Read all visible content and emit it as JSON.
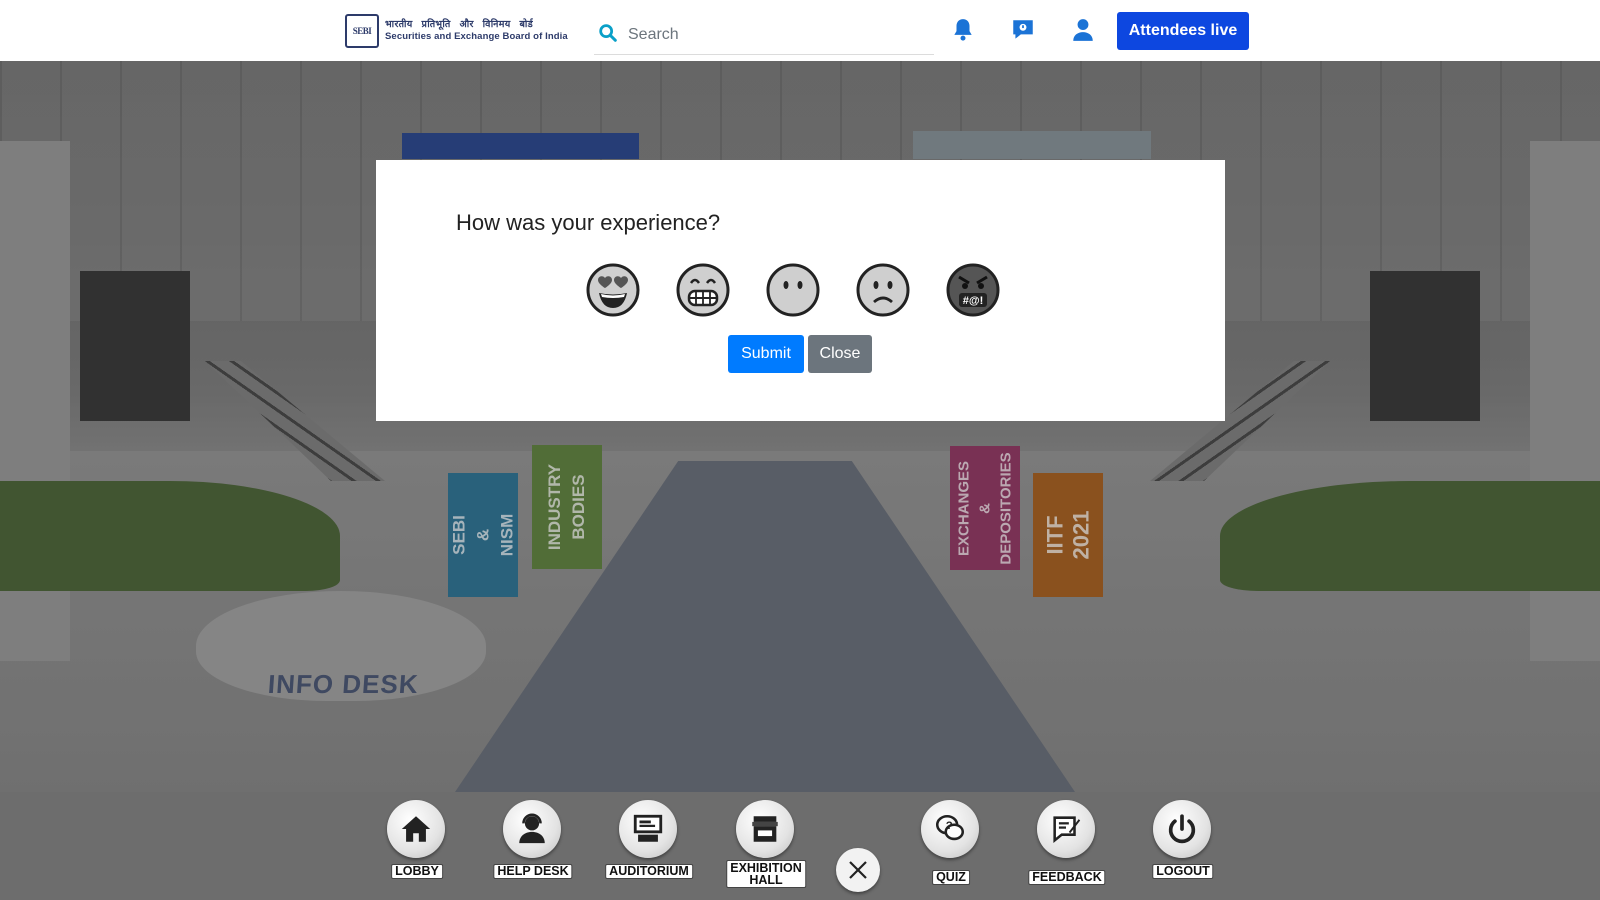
{
  "header": {
    "logo": {
      "hindi": "भारतीय प्रतिभूति और विनिमय बोर्ड",
      "english": "Securities and Exchange Board of India",
      "mark": "SEBI"
    },
    "search": {
      "placeholder": "Search",
      "value": ""
    },
    "attendees_button": "Attendees live",
    "icons": [
      "bell-icon",
      "chat-icon",
      "user-icon"
    ],
    "accent_color": "#0d47e0"
  },
  "scene": {
    "standees": [
      "SEBI\n&\nNISM",
      "INDUSTRY\nBODIES",
      "EXCHANGES\n&\nDEPOSITORIES",
      "IITF\n2021"
    ],
    "info_desk": "INFO DESK"
  },
  "modal": {
    "title": "How was your experience?",
    "emojis": [
      "heart-eyes",
      "grinning",
      "neutral",
      "frowning",
      "angry-cursing"
    ],
    "submit_label": "Submit",
    "close_label": "Close"
  },
  "bottom_nav": {
    "lobby": "LOBBY",
    "help_desk": "HELP DESK",
    "auditorium": "AUDITORIUM",
    "exhibition_hall": "EXHIBITION\nHALL",
    "quiz": "QUIZ",
    "feedback": "FEEDBACK",
    "logout": "LOGOUT"
  }
}
